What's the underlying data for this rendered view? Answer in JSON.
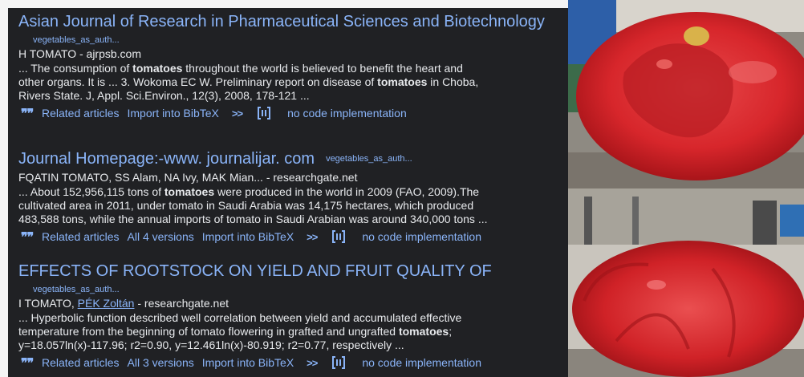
{
  "results": [
    {
      "title": "Asian Journal of Research in Pharmaceutical Sciences and Biotechnology",
      "tag": "vegetables_as_auth...",
      "author": "H TOMATO - ajrpsb.com",
      "snippet": [
        [
          "... The consumption of ",
          "tomatoes",
          " throughout the world is believed to benefit the heart and"
        ],
        [
          "other organs. It is ... 3. Wokoma EC W. Preliminary report on disease of ",
          "tomatoes",
          " in Choba,"
        ],
        [
          "Rivers State. J, Appl. Sci.Environ., 12(3), 2008, 178-121 ...",
          "",
          ""
        ]
      ],
      "actions": [
        "Related articles",
        "Import into BibTeX"
      ],
      "code": "no code implementation"
    },
    {
      "title": "Journal Homepage:-www. journalijar. com",
      "tag": "vegetables_as_auth...",
      "author": "FQATIN TOMATO, SS Alam, NA Ivy, MAK Mian... - researchgate.net",
      "snippet": [
        [
          "... About 152,956,115 tons of ",
          "tomatoes",
          " were produced in the world in 2009 (FAO, 2009).The"
        ],
        [
          "cultivated area in 2011, under tomato in Saudi Arabia was 14,175 hectares, which produced",
          "",
          ""
        ],
        [
          "483,588 tons, while the annual imports of tomato in Saudi Arabian was around 340,000 tons ...",
          "",
          ""
        ]
      ],
      "actions": [
        "Related articles",
        "All 4 versions",
        "Import into BibTeX"
      ],
      "code": "no code implementation"
    },
    {
      "title": "EFFECTS OF ROOTSTOCK ON YIELD AND FRUIT QUALITY OF",
      "tag": "vegetables_as_auth...",
      "author_prefix": "I TOMATO, ",
      "author_link": "PÉK Zoltán",
      "author_suffix": " - researchgate.net",
      "snippet": [
        [
          "... Hyperbolic function described well correlation between yield and accumulated effective",
          "",
          ""
        ],
        [
          "temperature from the beginning of tomato flowering in grafted and ungrafted ",
          "tomatoes",
          ";"
        ],
        [
          "y=18.057ln(x)-117.96; r2=0.90, y=12.461ln(x)-80.919; r2=0.77, respectively ...",
          "",
          ""
        ]
      ],
      "actions": [
        "Related articles",
        "All 3 versions",
        "Import into BibTeX"
      ],
      "code": "no code implementation"
    }
  ],
  "icons": {
    "quote": "quote-icon",
    "more": "more-icon",
    "code": "papers-with-code-icon"
  },
  "colors": {
    "background": "#202124",
    "link": "#8ab4f8",
    "text": "#e8eaed"
  }
}
